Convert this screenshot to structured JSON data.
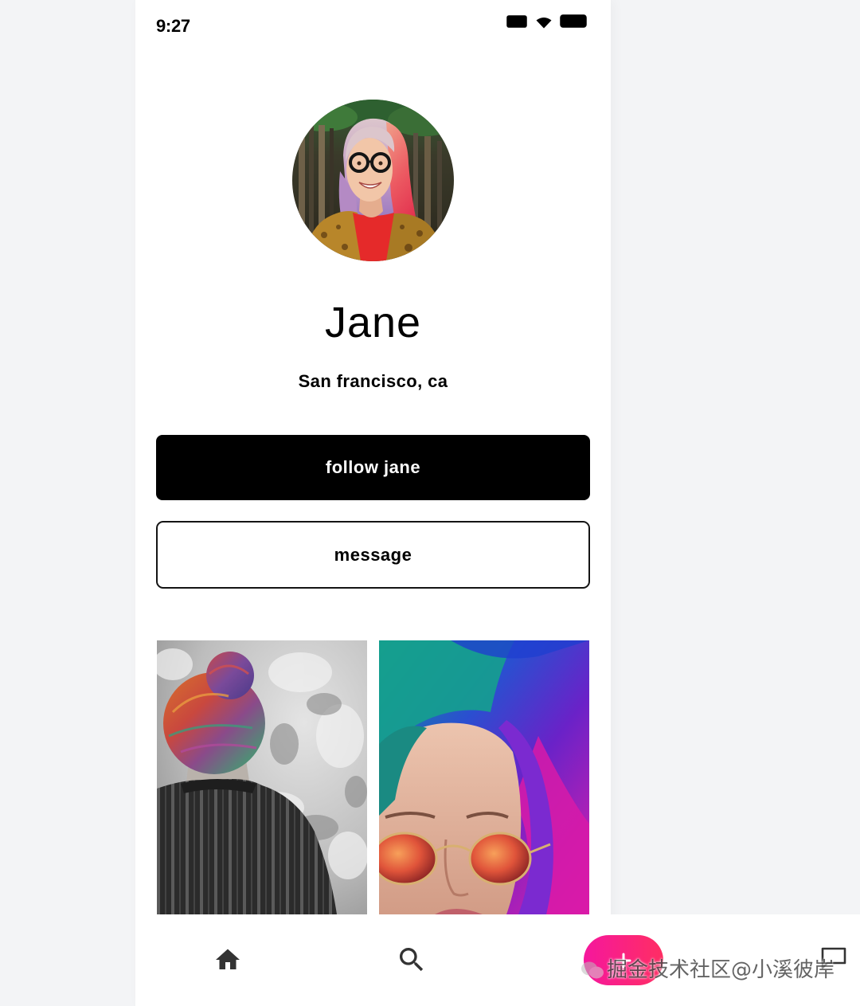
{
  "status_bar": {
    "time": "9:27",
    "icons": [
      "signal-icon",
      "wifi-icon",
      "battery-icon"
    ]
  },
  "profile": {
    "name": "Jane",
    "location": "San francisco, ca"
  },
  "actions": {
    "follow_label": "follow jane",
    "message_label": "message"
  },
  "bottom_nav": {
    "items": [
      {
        "icon": "home-icon"
      },
      {
        "icon": "search-icon"
      },
      {
        "icon": "add-icon"
      },
      {
        "icon": "chat-icon"
      }
    ]
  },
  "watermark": "掘金技术社区@小溪彼岸",
  "colors": {
    "page_background": "#f3f4f6",
    "screen_background": "#ffffff",
    "primary_button": "#000000",
    "primary_button_text": "#ffffff",
    "accent_gradient_start": "#f5179d",
    "accent_gradient_end": "#ff2e63",
    "nav_icon": "#333333"
  }
}
